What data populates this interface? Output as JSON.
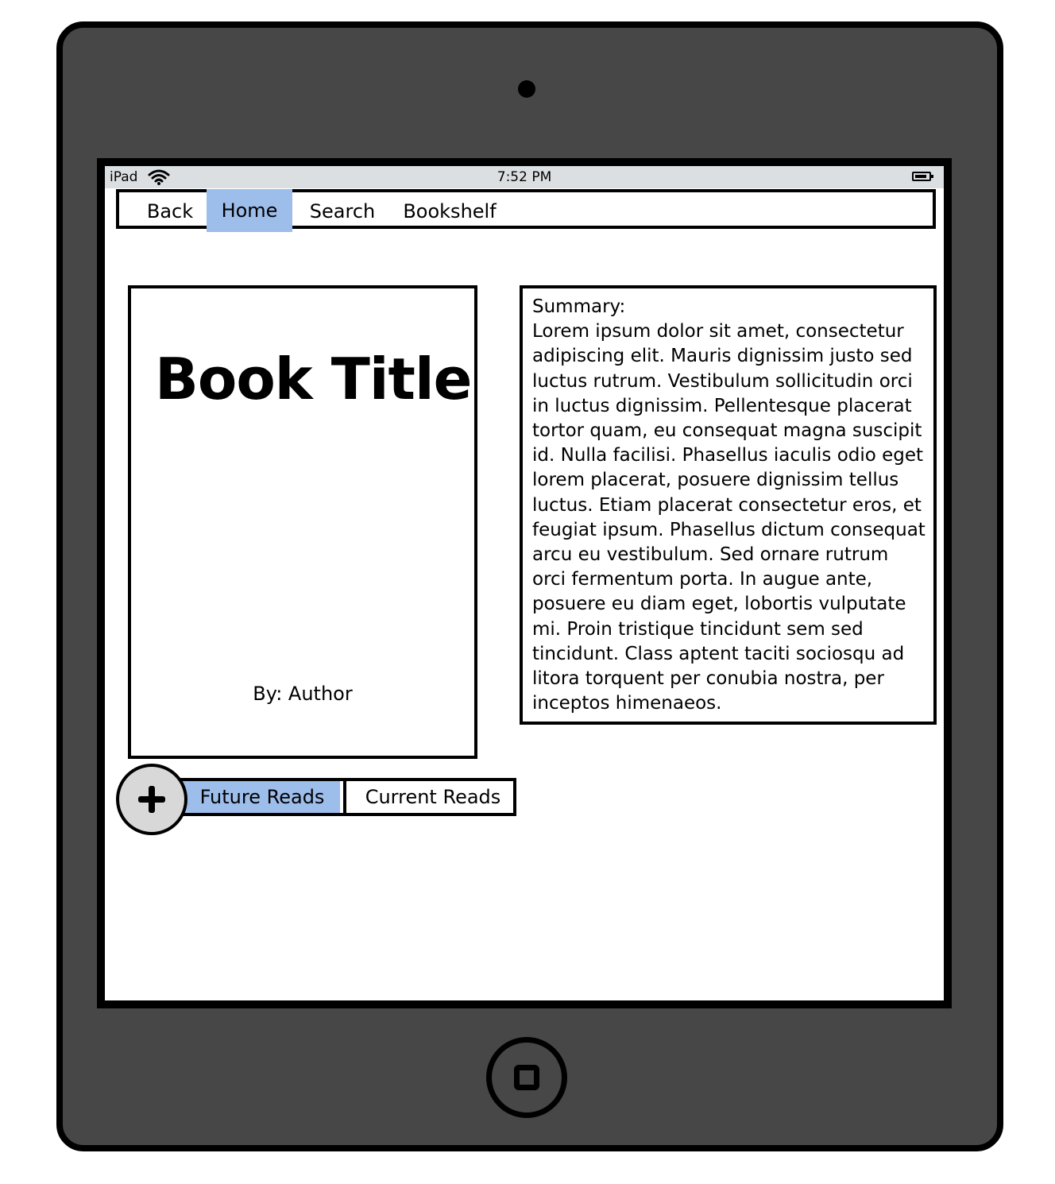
{
  "status_bar": {
    "carrier": "iPad",
    "time": "7:52 PM",
    "wifi_icon": "wifi-icon",
    "battery_icon": "battery-icon"
  },
  "nav": {
    "items": [
      {
        "label": "Back"
      },
      {
        "label": "Home",
        "selected": true
      },
      {
        "label": "Search"
      },
      {
        "label": "Bookshelf"
      }
    ]
  },
  "book": {
    "title": "Book Title",
    "author": "By: Author"
  },
  "summary": {
    "heading": "Summary:",
    "text": "Lorem ipsum dolor sit amet, consectetur adipiscing elit. Mauris dignissim justo sed luctus rutrum. Vestibulum sollicitudin orci in luctus dignissim. Pellentesque placerat tortor quam, eu consequat magna suscipit id. Nulla facilisi. Phasellus iaculis odio eget lorem placerat, posuere dignissim tellus luctus. Etiam placerat consectetur eros, et feugiat ipsum. Phasellus dictum consequat arcu eu vestibulum. Sed ornare rutrum orci fermentum porta. In augue ante, posuere eu diam eget, lobortis vulputate mi. Proin tristique tincidunt sem sed tincidunt. Class aptent taciti sociosqu ad litora torquent per conubia nostra, per inceptos himenaeos."
  },
  "actions": {
    "add_icon": "plus-icon",
    "tabs": [
      {
        "label": "Future Reads",
        "selected": true
      },
      {
        "label": "Current Reads"
      }
    ]
  },
  "colors": {
    "device": "#474747",
    "selected": "#9dbdea",
    "status_bar": "#dcdfe2"
  }
}
